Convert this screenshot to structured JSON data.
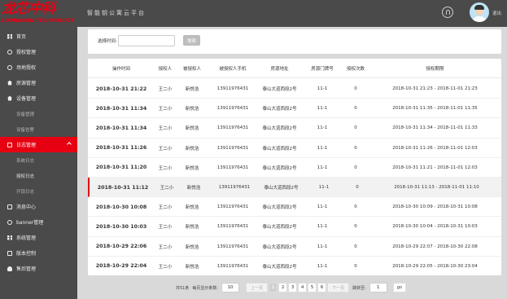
{
  "logo": {
    "main": "龙芯中科",
    "sub": "LOONGSON TECHNOLOGY"
  },
  "header": {
    "title": "智能钥公寓云平台",
    "logout": "退出"
  },
  "sidebar": {
    "items": [
      {
        "label": "首页",
        "icon": "grid-icon"
      },
      {
        "label": "授权管理",
        "icon": "circle-icon"
      },
      {
        "label": "场地授权",
        "icon": "circle-icon"
      },
      {
        "label": "房源管理",
        "icon": "home-icon"
      },
      {
        "label": "设备管理",
        "icon": "home-icon"
      },
      {
        "label": "设备管理",
        "sub": true
      },
      {
        "label": "设备告警",
        "sub": true
      },
      {
        "label": "日志管理",
        "icon": "box-icon",
        "active": true
      },
      {
        "label": "系统日志",
        "sub": true
      },
      {
        "label": "授权日志",
        "sub": true,
        "bright": true
      },
      {
        "label": "开锁日志",
        "sub": true
      },
      {
        "label": "消息中心",
        "icon": "box-icon"
      },
      {
        "label": "banner管理",
        "icon": "circle-icon"
      },
      {
        "label": "系统管理",
        "icon": "grid-icon"
      },
      {
        "label": "版本控制",
        "icon": "box-icon"
      },
      {
        "label": "售后管理",
        "icon": "user-icon"
      }
    ]
  },
  "filter": {
    "label": "选择时间:",
    "input_value": "",
    "search_label": "搜索"
  },
  "table": {
    "headers": [
      "操作时间",
      "授权人",
      "被授权人",
      "被授权人手机",
      "房源地址",
      "房源门牌号",
      "授权次数",
      "授权期限"
    ],
    "rows": [
      [
        "2018-10-31 21:22",
        "王二小",
        "新悦浩",
        "13911976431",
        "泰山大道西段2号",
        "11-1",
        "0",
        "2018-10-31 21:23 - 2018-11-01 21:23"
      ],
      [
        "2018-10-31 11:34",
        "王二小",
        "新悦浩",
        "13911976431",
        "泰山大道西段2号",
        "11-1",
        "0",
        "2018-10-31 11:35 - 2018-11-01 11:35"
      ],
      [
        "2018-10-31 11:34",
        "王二小",
        "新悦浩",
        "13911976431",
        "泰山大道西段2号",
        "11-1",
        "0",
        "2018-10-31 11:34 - 2018-11-01 11:33"
      ],
      [
        "2018-10-31 11:26",
        "王二小",
        "新悦浩",
        "13911976431",
        "泰山大道西段2号",
        "11-1",
        "0",
        "2018-10-31 11:26 - 2018-11-01 12:03"
      ],
      [
        "2018-10-31 11:20",
        "王二小",
        "新悦浩",
        "13911976431",
        "泰山大道西段2号",
        "11-1",
        "0",
        "2018-10-31 11:21 - 2018-11-01 12:03"
      ],
      [
        "2018-10-31 11:12",
        "王二小",
        "新悦浩",
        "13911976431",
        "泰山大道西段2号",
        "11-1",
        "0",
        "2018-10-31 11:13 - 2018-11-01 11:10"
      ],
      [
        "2018-10-30 10:08",
        "王二小",
        "新悦浩",
        "13911976431",
        "泰山大道西段2号",
        "11-1",
        "0",
        "2018-10-30 10:09 - 2018-10-31 10:08"
      ],
      [
        "2018-10-30 10:03",
        "王二小",
        "新悦浩",
        "13911976431",
        "泰山大道西段2号",
        "11-1",
        "0",
        "2018-10-30 10:04 - 2018-10-31 10:03"
      ],
      [
        "2018-10-29 22:06",
        "王二小",
        "新悦浩",
        "13911976431",
        "泰山大道西段2号",
        "11-1",
        "0",
        "2018-10-29 22:07 - 2018-10-30 22:08"
      ],
      [
        "2018-10-29 22:04",
        "王二小",
        "新悦浩",
        "13911976431",
        "泰山大道西段2号",
        "11-1",
        "0",
        "2018-10-29 22:05 - 2018-10-30 23:04"
      ]
    ],
    "highlighted_row": 5
  },
  "pagination": {
    "total": "共51条",
    "per_page_label": "每页显示条数:",
    "per_page_value": "10",
    "prev": "上一页",
    "pages": [
      "1",
      "2",
      "3",
      "4",
      "5",
      "6"
    ],
    "current_page": "1",
    "next": "下一页",
    "jump_label": "跳转至:",
    "jump_value": "1",
    "go": "go"
  },
  "colors": {
    "accent": "#e60012",
    "sidebar_bg": "#4a4a4a",
    "content_bg": "#d9d9d9"
  }
}
